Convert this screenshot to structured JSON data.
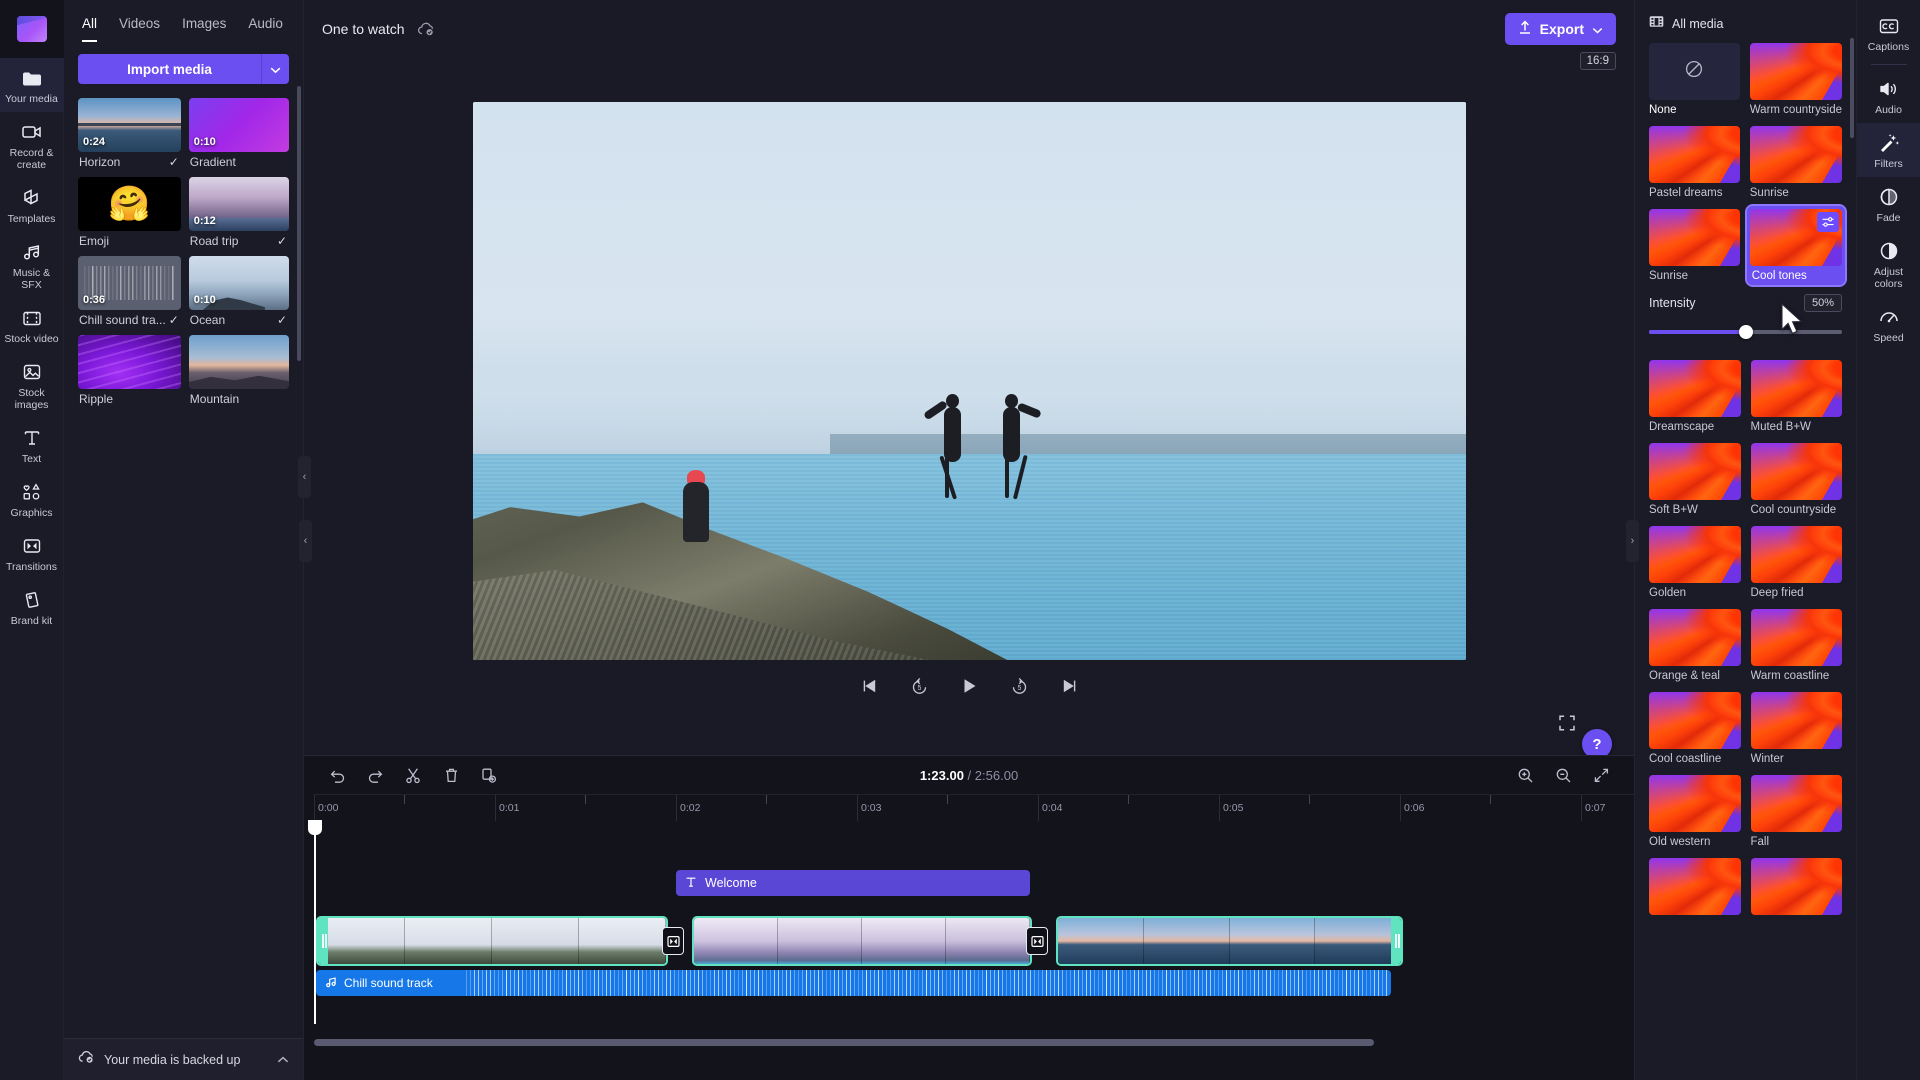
{
  "left_rail": {
    "logo": "clapperboard-logo",
    "items": [
      {
        "label": "Your media",
        "icon": "folder-icon",
        "active": true
      },
      {
        "label": "Record & create",
        "icon": "camera-icon",
        "active": false
      },
      {
        "label": "Templates",
        "icon": "templates-icon",
        "active": false
      },
      {
        "label": "Music & SFX",
        "icon": "music-note-icon",
        "active": false
      },
      {
        "label": "Stock video",
        "icon": "film-strip-icon",
        "active": false
      },
      {
        "label": "Stock images",
        "icon": "image-icon",
        "active": false
      },
      {
        "label": "Text",
        "icon": "text-t-icon",
        "active": false
      },
      {
        "label": "Graphics",
        "icon": "shapes-icon",
        "active": false
      },
      {
        "label": "Transitions",
        "icon": "transition-icon",
        "active": false
      },
      {
        "label": "Brand kit",
        "icon": "brandkit-icon",
        "active": false
      }
    ]
  },
  "media_panel": {
    "tabs": [
      {
        "label": "All",
        "active": true
      },
      {
        "label": "Videos",
        "active": false
      },
      {
        "label": "Images",
        "active": false
      },
      {
        "label": "Audio",
        "active": false
      }
    ],
    "import_button": "Import media",
    "import_caret_icon": "chevron-down-icon",
    "items": [
      {
        "name": "Horizon",
        "duration": "0:24",
        "used": true,
        "kind": "seascape"
      },
      {
        "name": "Gradient",
        "duration": "0:10",
        "used": false,
        "kind": "gradient"
      },
      {
        "name": "Emoji",
        "duration": "",
        "used": false,
        "kind": "emoji"
      },
      {
        "name": "Road trip",
        "duration": "0:12",
        "used": true,
        "kind": "road"
      },
      {
        "name": "Chill sound tra...",
        "duration": "0:36",
        "used": true,
        "kind": "audio"
      },
      {
        "name": "Ocean",
        "duration": "0:10",
        "used": true,
        "kind": "ocean"
      },
      {
        "name": "Ripple",
        "duration": "",
        "used": false,
        "kind": "ripple"
      },
      {
        "name": "Mountain",
        "duration": "",
        "used": false,
        "kind": "mountain"
      }
    ],
    "backup_status": "Your media is backed up",
    "backup_icon": "cloud-check-icon",
    "backup_caret_icon": "chevron-up-icon"
  },
  "header": {
    "project_title": "One to watch",
    "saved_icon": "cloud-check-icon",
    "export_label": "Export",
    "export_icon": "upload-icon",
    "export_caret_icon": "chevron-down-icon"
  },
  "preview": {
    "aspect_ratio_badge": "16:9",
    "controls": [
      {
        "name": "skip-to-start-button",
        "icon": "skip-start-icon"
      },
      {
        "name": "rewind-5-button",
        "icon": "rewind-5-icon"
      },
      {
        "name": "play-button",
        "icon": "play-icon"
      },
      {
        "name": "forward-5-button",
        "icon": "forward-5-icon"
      },
      {
        "name": "skip-to-end-button",
        "icon": "skip-end-icon"
      }
    ],
    "fullscreen_icon": "fullscreen-icon",
    "help_label": "?"
  },
  "timeline": {
    "tools": [
      {
        "name": "undo-button",
        "icon": "undo-icon"
      },
      {
        "name": "redo-button",
        "icon": "redo-icon"
      },
      {
        "name": "split-button",
        "icon": "scissors-icon"
      },
      {
        "name": "delete-button",
        "icon": "trash-icon"
      },
      {
        "name": "duplicate-button",
        "icon": "duplicate-icon"
      }
    ],
    "current_time": "1:23.00",
    "separator": "/",
    "total_time": "2:56.00",
    "zoom_controls": [
      {
        "name": "zoom-in-button",
        "icon": "zoom-in-icon"
      },
      {
        "name": "zoom-out-button",
        "icon": "zoom-out-icon"
      },
      {
        "name": "fit-button",
        "icon": "fit-to-screen-icon"
      }
    ],
    "ruler_labels": [
      "0:00",
      "0:01",
      "0:02",
      "0:03",
      "0:04",
      "0:05",
      "0:06",
      "0:07"
    ],
    "text_clip": {
      "label": "Welcome",
      "icon": "text-t-icon"
    },
    "video_clips": [
      {
        "name": "clip-road-trip",
        "kind": "road"
      },
      {
        "name": "clip-ocean",
        "kind": "fog"
      },
      {
        "name": "clip-horizon",
        "kind": "sunset"
      }
    ],
    "transitions": [
      {
        "name": "transition-1",
        "icon": "transition-icon"
      },
      {
        "name": "transition-2",
        "icon": "transition-icon"
      }
    ],
    "audio_clip": {
      "label": "Chill sound track",
      "icon": "music-note-icon"
    }
  },
  "filters_panel": {
    "header": "All media",
    "header_icon": "film-strip-icon",
    "items": [
      {
        "name": "None",
        "selected": false,
        "none": true
      },
      {
        "name": "Warm countryside",
        "selected": false
      },
      {
        "name": "Pastel dreams",
        "selected": false
      },
      {
        "name": "Sunrise",
        "selected": false
      },
      {
        "name": "Sunrise",
        "selected": false
      },
      {
        "name": "Cool tones",
        "selected": true
      },
      {
        "name": "Dreamscape",
        "selected": false
      },
      {
        "name": "Muted B+W",
        "selected": false
      },
      {
        "name": "Soft B+W",
        "selected": false
      },
      {
        "name": "Cool countryside",
        "selected": false
      },
      {
        "name": "Golden",
        "selected": false
      },
      {
        "name": "Deep fried",
        "selected": false
      },
      {
        "name": "Orange & teal",
        "selected": false
      },
      {
        "name": "Warm coastline",
        "selected": false
      },
      {
        "name": "Cool coastline",
        "selected": false
      },
      {
        "name": "Winter",
        "selected": false
      },
      {
        "name": "Old western",
        "selected": false
      },
      {
        "name": "Fall",
        "selected": false
      }
    ],
    "intensity_label": "Intensity",
    "intensity_value": "50%",
    "intensity_percent": 50,
    "accent_color": "#6b4ff0"
  },
  "right_rail": {
    "items": [
      {
        "label": "Captions",
        "icon": "cc-icon",
        "active": false
      },
      {
        "label": "Audio",
        "icon": "speaker-icon",
        "active": false
      },
      {
        "label": "Filters",
        "icon": "magic-wand-icon",
        "active": true
      },
      {
        "label": "Fade",
        "icon": "fade-circle-icon",
        "active": false
      },
      {
        "label": "Adjust colors",
        "icon": "contrast-icon",
        "active": false
      },
      {
        "label": "Speed",
        "icon": "speedometer-icon",
        "active": false
      }
    ]
  }
}
